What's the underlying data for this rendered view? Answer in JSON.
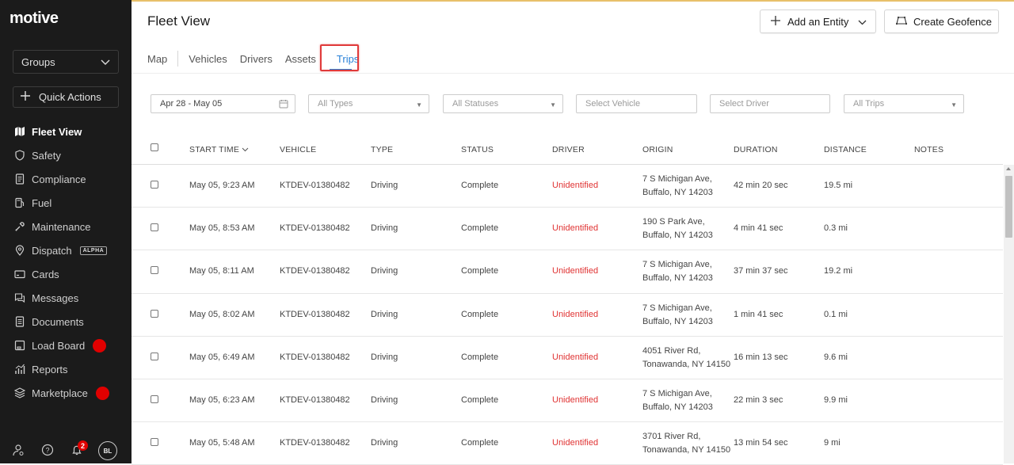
{
  "sidebar": {
    "logo": "motive",
    "groups_label": "Groups",
    "quick_actions_label": "Quick Actions",
    "items": [
      {
        "label": "Fleet View",
        "icon": "map-icon",
        "active": true
      },
      {
        "label": "Safety",
        "icon": "shield-icon"
      },
      {
        "label": "Compliance",
        "icon": "document-icon"
      },
      {
        "label": "Fuel",
        "icon": "fuel-icon"
      },
      {
        "label": "Maintenance",
        "icon": "wrench-icon"
      },
      {
        "label": "Dispatch",
        "icon": "location-pin-icon",
        "tag": "ALPHA"
      },
      {
        "label": "Cards",
        "icon": "card-icon"
      },
      {
        "label": "Messages",
        "icon": "messages-icon"
      },
      {
        "label": "Documents",
        "icon": "documents-icon"
      },
      {
        "label": "Load Board",
        "icon": "load-board-icon",
        "red_dot": true
      },
      {
        "label": "Reports",
        "icon": "reports-icon"
      },
      {
        "label": "Marketplace",
        "icon": "marketplace-icon",
        "red_dot": true
      }
    ],
    "notification_count": "2",
    "avatar_initials": "BL"
  },
  "header": {
    "title": "Fleet View",
    "add_entity_label": "Add an Entity",
    "create_geofence_label": "Create Geofence"
  },
  "tabs": [
    {
      "label": "Map"
    },
    {
      "label": "Vehicles"
    },
    {
      "label": "Drivers"
    },
    {
      "label": "Assets"
    },
    {
      "label": "Trips",
      "active": true
    }
  ],
  "filters": {
    "date_range": "Apr 28 - May 05",
    "types": "All Types",
    "statuses": "All Statuses",
    "vehicle_placeholder": "Select Vehicle",
    "driver_placeholder": "Select Driver",
    "trips": "All Trips"
  },
  "table": {
    "columns": {
      "start_time": "START TIME",
      "vehicle": "VEHICLE",
      "type": "TYPE",
      "status": "STATUS",
      "driver": "DRIVER",
      "origin": "ORIGIN",
      "duration": "DURATION",
      "distance": "DISTANCE",
      "notes": "NOTES"
    },
    "rows": [
      {
        "start_time": "May 05, 9:23 AM",
        "vehicle": "KTDEV-01380482",
        "type": "Driving",
        "status": "Complete",
        "driver": "Unidentified",
        "origin_line1": "7 S Michigan Ave,",
        "origin_line2": "Buffalo, NY 14203",
        "duration": "42 min 20 sec",
        "distance": "19.5 mi"
      },
      {
        "start_time": "May 05, 8:53 AM",
        "vehicle": "KTDEV-01380482",
        "type": "Driving",
        "status": "Complete",
        "driver": "Unidentified",
        "origin_line1": "190 S Park Ave,",
        "origin_line2": "Buffalo, NY 14203",
        "duration": "4 min 41 sec",
        "distance": "0.3 mi"
      },
      {
        "start_time": "May 05, 8:11 AM",
        "vehicle": "KTDEV-01380482",
        "type": "Driving",
        "status": "Complete",
        "driver": "Unidentified",
        "origin_line1": "7 S Michigan Ave,",
        "origin_line2": "Buffalo, NY 14203",
        "duration": "37 min 37 sec",
        "distance": "19.2 mi"
      },
      {
        "start_time": "May 05, 8:02 AM",
        "vehicle": "KTDEV-01380482",
        "type": "Driving",
        "status": "Complete",
        "driver": "Unidentified",
        "origin_line1": "7 S Michigan Ave,",
        "origin_line2": "Buffalo, NY 14203",
        "duration": "1 min 41 sec",
        "distance": "0.1 mi"
      },
      {
        "start_time": "May 05, 6:49 AM",
        "vehicle": "KTDEV-01380482",
        "type": "Driving",
        "status": "Complete",
        "driver": "Unidentified",
        "origin_line1": "4051 River Rd,",
        "origin_line2": "Tonawanda, NY 14150",
        "duration": "16 min 13 sec",
        "distance": "9.6 mi"
      },
      {
        "start_time": "May 05, 6:23 AM",
        "vehicle": "KTDEV-01380482",
        "type": "Driving",
        "status": "Complete",
        "driver": "Unidentified",
        "origin_line1": "7 S Michigan Ave,",
        "origin_line2": "Buffalo, NY 14203",
        "duration": "22 min 3 sec",
        "distance": "9.9 mi"
      },
      {
        "start_time": "May 05, 5:48 AM",
        "vehicle": "KTDEV-01380482",
        "type": "Driving",
        "status": "Complete",
        "driver": "Unidentified",
        "origin_line1": "3701 River Rd,",
        "origin_line2": "Tonawanda, NY 14150",
        "duration": "13 min 54 sec",
        "distance": "9 mi"
      }
    ]
  },
  "colors": {
    "sidebar_bg": "#1b1b1b",
    "accent_blue": "#2a82d8",
    "driver_red": "#e03333",
    "highlight_red": "#e03a3a"
  }
}
